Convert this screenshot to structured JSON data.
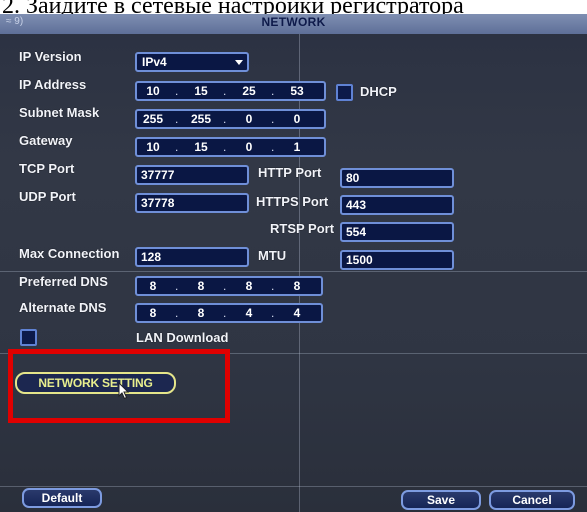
{
  "caption": "2. Зайдите в сетевые настройки регистратора",
  "window": {
    "title": "NETWORK",
    "corner_mark": "≈ 9)"
  },
  "labels": {
    "ip_version": "IP Version",
    "ip_address": "IP Address",
    "subnet_mask": "Subnet Mask",
    "gateway": "Gateway",
    "tcp_port": "TCP Port",
    "udp_port": "UDP Port",
    "http_port": "HTTP Port",
    "https_port": "HTTPS Port",
    "rtsp_port": "RTSP Port",
    "max_connection": "Max Connection",
    "mtu": "MTU",
    "preferred_dns": "Preferred DNS",
    "alternate_dns": "Alternate DNS",
    "dhcp": "DHCP",
    "lan_download": "LAN Download"
  },
  "values": {
    "ip_version": "IPv4",
    "ip_address": [
      "10",
      "15",
      "25",
      "53"
    ],
    "subnet_mask": [
      "255",
      "255",
      "0",
      "0"
    ],
    "gateway": [
      "10",
      "15",
      "0",
      "1"
    ],
    "tcp_port": "37777",
    "udp_port": "37778",
    "http_port": "80",
    "https_port": "443",
    "rtsp_port": "554",
    "max_connection": "128",
    "mtu": "1500",
    "preferred_dns": [
      "8",
      "8",
      "8",
      "8"
    ],
    "alternate_dns": [
      "8",
      "8",
      "4",
      "4"
    ],
    "dot": "."
  },
  "checkboxes": {
    "dhcp_checked": false,
    "lan_download_checked": false
  },
  "buttons": {
    "network_setting": "NETWORK SETTING",
    "default": "Default",
    "save": "Save",
    "cancel": "Cancel"
  },
  "colors": {
    "highlight_box": "#e00000",
    "field_border": "#6f8fd8",
    "panel_bg": "#2f3543"
  }
}
